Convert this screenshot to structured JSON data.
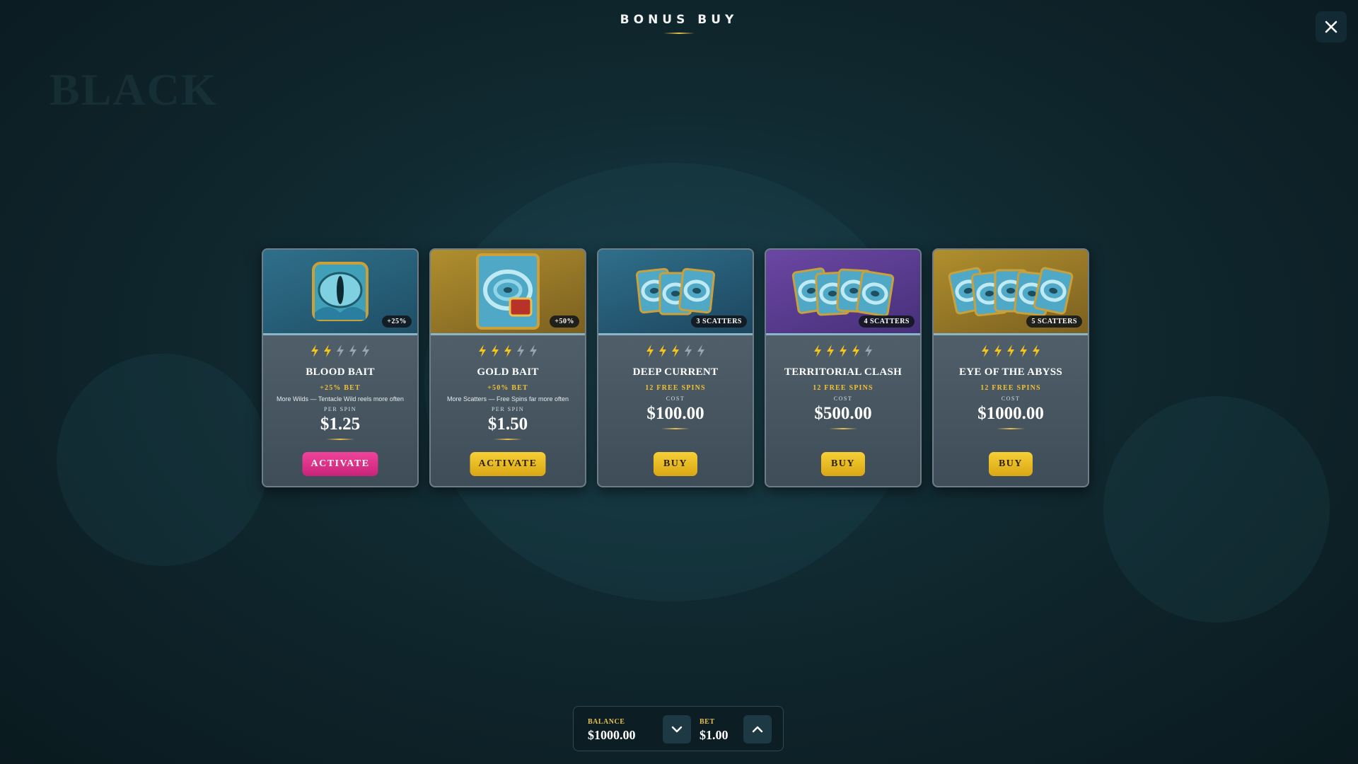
{
  "header": {
    "title": "BONUS BUY"
  },
  "cards": [
    {
      "name": "BLOOD BAIT",
      "tag": "+25%",
      "level": 2,
      "sub": "+25% BET",
      "desc": "More Wilds — Tentacle Wild reels more often",
      "caption": "PER SPIN",
      "price": "$1.25",
      "button": "ACTIVATE",
      "button_style": "pink",
      "icon": "eye-icon"
    },
    {
      "name": "GOLD BAIT",
      "tag": "+50%",
      "level": 3,
      "sub": "+50% BET",
      "desc": "More Scatters — Free Spins far more often",
      "caption": "PER SPIN",
      "price": "$1.50",
      "button": "ACTIVATE",
      "button_style": "gold",
      "icon": "whirlpool-icon"
    },
    {
      "name": "DEEP CURRENT",
      "tag": "3 SCATTERS",
      "level": 3,
      "sub": "12 FREE SPINS",
      "desc": "",
      "caption": "COST",
      "price": "$100.00",
      "button": "BUY",
      "button_style": "gold",
      "icon": "scatter-icon",
      "scatters": 3
    },
    {
      "name": "TERRITORIAL CLASH",
      "tag": "4 SCATTERS",
      "level": 4,
      "sub": "12 FREE SPINS",
      "desc": "",
      "caption": "COST",
      "price": "$500.00",
      "button": "BUY",
      "button_style": "gold",
      "icon": "scatter-icon",
      "scatters": 4
    },
    {
      "name": "EYE OF THE ABYSS",
      "tag": "5 SCATTERS",
      "level": 5,
      "sub": "12 FREE SPINS",
      "desc": "",
      "caption": "COST",
      "price": "$1000.00",
      "button": "BUY",
      "button_style": "gold",
      "icon": "scatter-icon",
      "scatters": 5
    }
  ],
  "max_level": 5,
  "footer": {
    "balance_label": "BALANCE",
    "balance": "$1000.00",
    "bet_label": "BET",
    "bet": "$1.00"
  },
  "colors": {
    "accent_gold": "#f2c230",
    "pink": "#e0338c",
    "bolt_on": "#f5c518",
    "bolt_off": "#9aa6ae"
  }
}
